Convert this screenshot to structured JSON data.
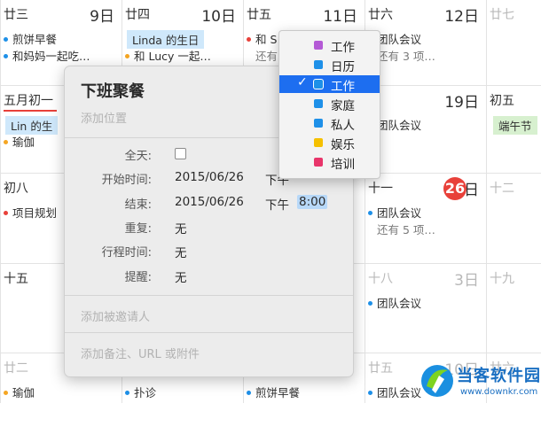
{
  "calendar": {
    "rows": [
      {
        "cells": [
          {
            "lunar": "廿三",
            "day": "9日",
            "dim": false,
            "events": [
              {
                "text": "煎饼早餐",
                "dot": "#1e90e8"
              },
              {
                "text": "和妈妈一起吃…",
                "dot": "#1e90e8"
              }
            ]
          },
          {
            "lunar": "廿四",
            "day": "10日",
            "dim": false,
            "events": [
              {
                "text": "Linda 的生日",
                "bar": "#cfe8fb"
              },
              {
                "text": "和 Lucy 一起…",
                "dot": "#f5a623"
              }
            ]
          },
          {
            "lunar": "廿五",
            "day": "11日",
            "dim": false,
            "events": [
              {
                "text": "和 S",
                "dot": "#e8413a"
              },
              {
                "text": "还有",
                "more": true
              }
            ]
          },
          {
            "lunar": "廿六",
            "day": "12日",
            "dim": false,
            "events": [
              {
                "text": "团队会议",
                "dot": "#1e90e8"
              },
              {
                "text": "还有 3 项…",
                "more": true
              }
            ]
          },
          {
            "lunar": "廿七",
            "day": "",
            "dim": true,
            "events": []
          }
        ]
      },
      {
        "cells": [
          {
            "lunar": "五月初一",
            "day": "",
            "dim": false,
            "events": [
              {
                "text": "Lin 的生",
                "bar": "#cfe8fb"
              },
              {
                "text": "瑜伽",
                "dot": "#f5a623"
              }
            ]
          },
          {
            "lunar": "",
            "day": "",
            "dim": false,
            "events": []
          },
          {
            "lunar": "",
            "day": "",
            "dim": false,
            "events": []
          },
          {
            "lunar": "",
            "day": "19日",
            "dim": false,
            "events": [
              {
                "text": "团队会议",
                "dot": "#1e90e8"
              }
            ]
          },
          {
            "lunar": "初五",
            "day": "",
            "dim": false,
            "events": [
              {
                "text": "端午节",
                "bar": "#d7f0cf"
              }
            ]
          }
        ]
      },
      {
        "cells": [
          {
            "lunar": "初八",
            "day": "",
            "dim": false,
            "events": [
              {
                "text": "项目规划",
                "dot": "#e8413a"
              }
            ]
          },
          {
            "lunar": "",
            "day": "",
            "dim": false,
            "events": []
          },
          {
            "lunar": "",
            "day": "",
            "dim": false,
            "events": []
          },
          {
            "lunar": "十一",
            "day": "日",
            "today": "26",
            "dim": false,
            "events": [
              {
                "text": "团队会议",
                "dot": "#1e90e8"
              },
              {
                "text": "还有 5 项…",
                "more": true
              }
            ]
          },
          {
            "lunar": "十二",
            "day": "",
            "dim": true,
            "events": []
          }
        ]
      },
      {
        "cells": [
          {
            "lunar": "十五",
            "day": "",
            "dim": false,
            "events": []
          },
          {
            "lunar": "",
            "day": "",
            "dim": false,
            "events": []
          },
          {
            "lunar": "",
            "day": "",
            "dim": false,
            "events": []
          },
          {
            "lunar": "十八",
            "day": "3日",
            "dim": true,
            "events": [
              {
                "text": "团队会议",
                "dot": "#1e90e8"
              }
            ]
          },
          {
            "lunar": "十九",
            "day": "",
            "dim": true,
            "events": []
          }
        ]
      },
      {
        "cells": [
          {
            "lunar": "廿二",
            "day": "",
            "dim": true,
            "events": [
              {
                "text": "瑜伽",
                "dot": "#f5a623"
              }
            ]
          },
          {
            "lunar": "",
            "day": "",
            "dim": false,
            "events": [
              {
                "text": "扑诊",
                "dot": "#1e90e8"
              }
            ]
          },
          {
            "lunar": "",
            "day": "",
            "dim": false,
            "events": [
              {
                "text": "煎饼早餐",
                "dot": "#1e90e8"
              }
            ]
          },
          {
            "lunar": "廿五",
            "day": "10日",
            "dim": true,
            "events": [
              {
                "text": "团队会议",
                "dot": "#1e90e8"
              }
            ]
          },
          {
            "lunar": "廿六",
            "day": "",
            "dim": true,
            "events": []
          }
        ]
      }
    ]
  },
  "popover": {
    "title": "下班聚餐",
    "location_placeholder": "添加位置",
    "allday_label": "全天:",
    "start_label": "开始时间:",
    "start_date": "2015/06/26",
    "start_time": "下午",
    "end_label": "结束:",
    "end_date": "2015/06/26",
    "end_ampm": "下午",
    "end_time": "8:00",
    "repeat_label": "重复:",
    "repeat_value": "无",
    "travel_label": "行程时间:",
    "travel_value": "无",
    "alert_label": "提醒:",
    "alert_value": "无",
    "invitees_placeholder": "添加被邀请人",
    "notes_placeholder": "添加备注、URL 或附件"
  },
  "menu": {
    "items": [
      {
        "label": "工作",
        "color": "#b45ad6",
        "selected": false
      },
      {
        "label": "日历",
        "color": "#1e90e8",
        "selected": false
      },
      {
        "label": "工作",
        "color": "#1e90e8",
        "selected": true
      },
      {
        "label": "家庭",
        "color": "#1e90e8",
        "selected": false
      },
      {
        "label": "私人",
        "color": "#1e90e8",
        "selected": false
      },
      {
        "label": "娱乐",
        "color": "#f5c000",
        "selected": false
      },
      {
        "label": "培训",
        "color": "#e8356a",
        "selected": false
      }
    ]
  },
  "watermark": {
    "title": "当客软件园",
    "url": "www.downkr.com"
  },
  "colors": {
    "accent": "#1d6ef0",
    "today": "#e8413a",
    "arrow": "#e8412f"
  }
}
